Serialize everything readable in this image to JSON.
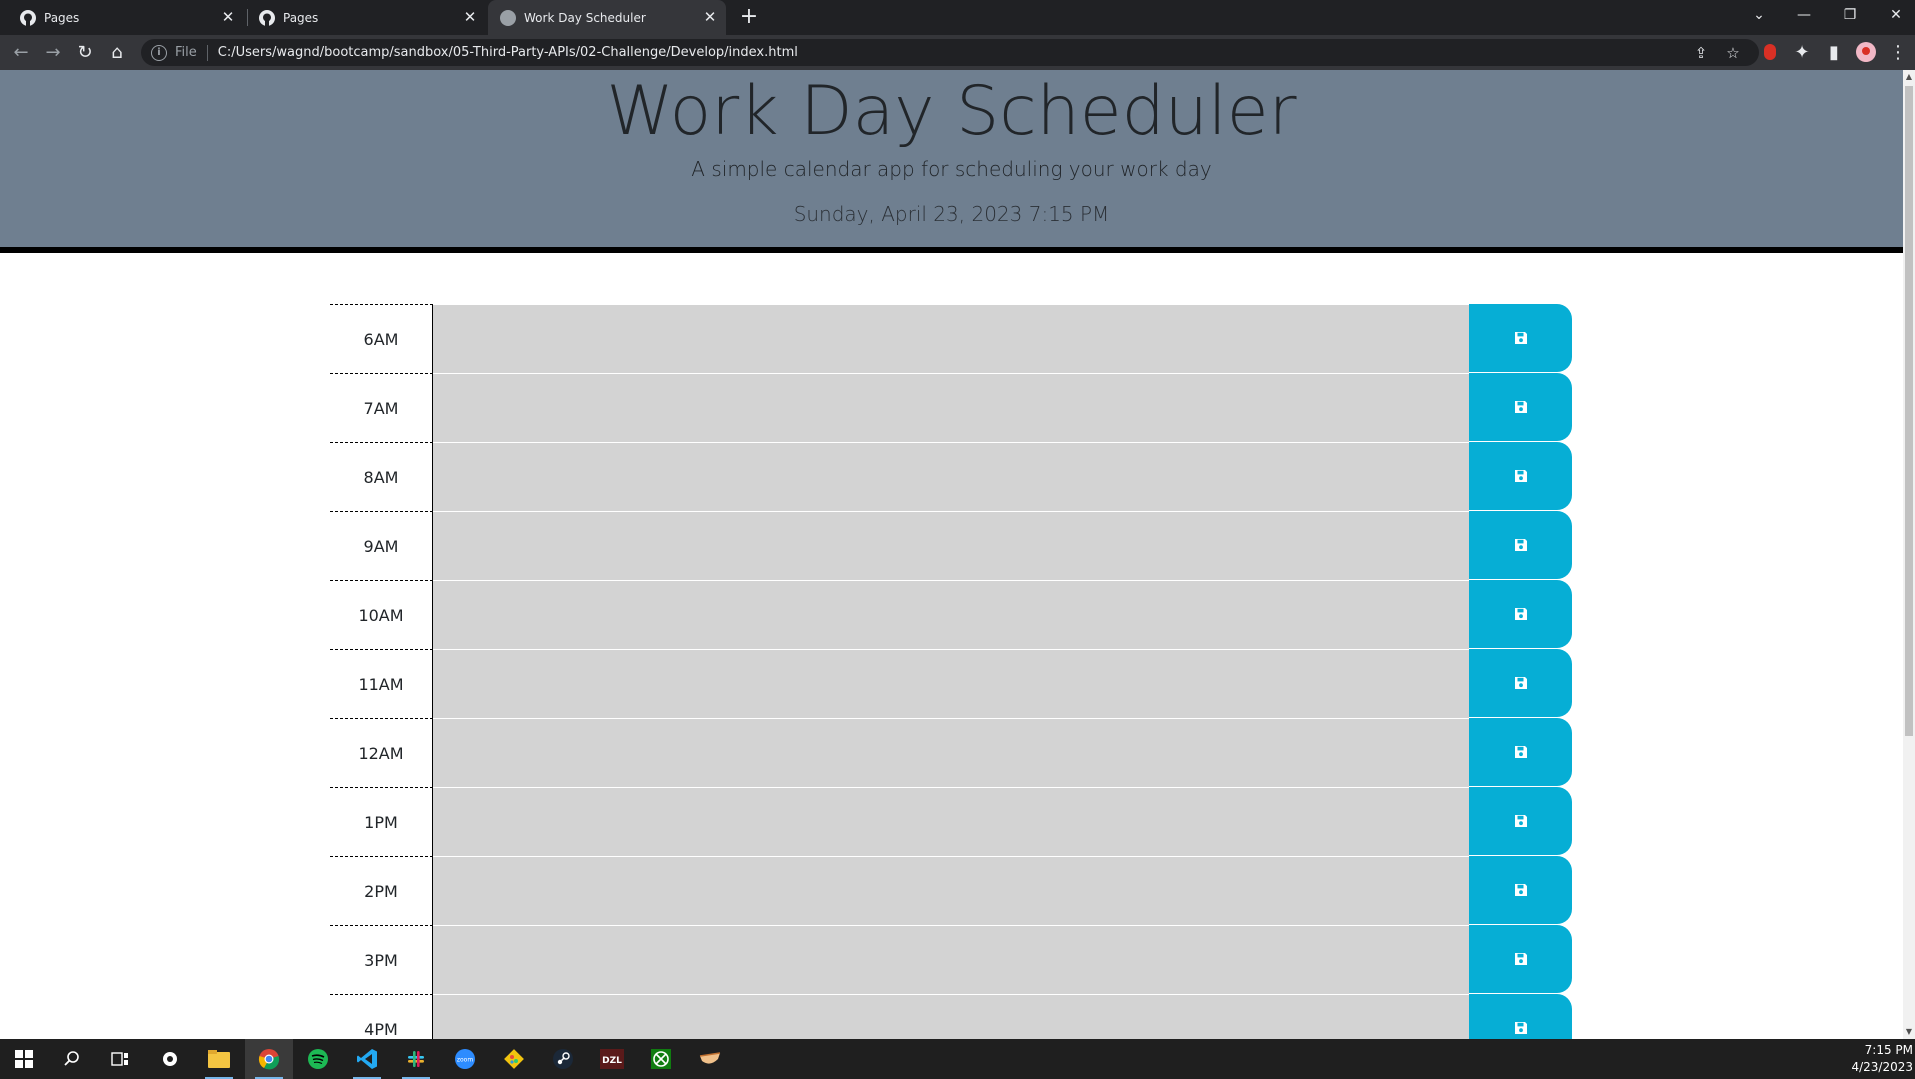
{
  "browser": {
    "tabs": [
      {
        "title": "Pages",
        "active": false
      },
      {
        "title": "Pages",
        "active": false
      },
      {
        "title": "Work Day Scheduler",
        "active": true
      }
    ],
    "omnibox": {
      "scheme_label": "File",
      "url": "C:/Users/wagnd/bootcamp/sandbox/05-Third-Party-APIs/02-Challenge/Develop/index.html"
    }
  },
  "page": {
    "title": "Work Day Scheduler",
    "lead": "A simple calendar app for scheduling your work day",
    "current_day": "Sunday, April 23, 2023 7:15 PM",
    "time_blocks": [
      {
        "hour": "6AM",
        "text": ""
      },
      {
        "hour": "7AM",
        "text": ""
      },
      {
        "hour": "8AM",
        "text": ""
      },
      {
        "hour": "9AM",
        "text": ""
      },
      {
        "hour": "10AM",
        "text": ""
      },
      {
        "hour": "11AM",
        "text": ""
      },
      {
        "hour": "12AM",
        "text": ""
      },
      {
        "hour": "1PM",
        "text": ""
      },
      {
        "hour": "2PM",
        "text": ""
      },
      {
        "hour": "3PM",
        "text": ""
      },
      {
        "hour": "4PM",
        "text": ""
      }
    ],
    "colors": {
      "header_bg": "#6f7f90",
      "past_row": "#d3d3d3",
      "save_button": "#06aed5"
    }
  },
  "taskbar": {
    "apps": [
      "start-icon",
      "search-icon",
      "task-view-icon",
      "settings-icon",
      "file-explorer-icon",
      "chrome-icon",
      "spotify-icon",
      "vscode-icon",
      "slack-icon",
      "zoom-icon",
      "git-icon",
      "steam-icon",
      "dzl-icon",
      "xbox-icon",
      "app-icon"
    ],
    "zoom_label": "zoom",
    "dzl_label": "DZL",
    "time": "7:15 PM",
    "date": "4/23/2023"
  }
}
